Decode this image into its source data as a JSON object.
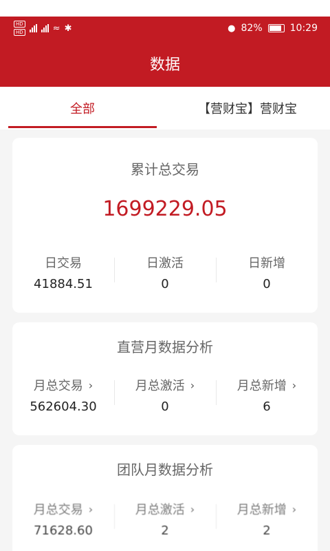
{
  "status": {
    "battery": "82%",
    "time": "10:29"
  },
  "header": {
    "title": "数据"
  },
  "tabs": [
    {
      "label": "全部"
    },
    {
      "label": "【营财宝】营财宝"
    }
  ],
  "total_card": {
    "title": "累计总交易",
    "amount": "1699229.05",
    "stats": [
      {
        "label": "日交易",
        "value": "41884.51"
      },
      {
        "label": "日激活",
        "value": "0"
      },
      {
        "label": "日新增",
        "value": "0"
      }
    ]
  },
  "direct_card": {
    "title": "直营月数据分析",
    "stats": [
      {
        "label": "月总交易",
        "value": "562604.30"
      },
      {
        "label": "月总激活",
        "value": "0"
      },
      {
        "label": "月总新增",
        "value": "6"
      }
    ]
  },
  "team_card": {
    "title": "团队月数据分析",
    "stats": [
      {
        "label": "月总交易",
        "value": "71628.60"
      },
      {
        "label": "月总激活",
        "value": "2"
      },
      {
        "label": "月总新增",
        "value": "2"
      }
    ]
  },
  "colors": {
    "brand": "#c21b23",
    "background": "#f5f5f5"
  }
}
